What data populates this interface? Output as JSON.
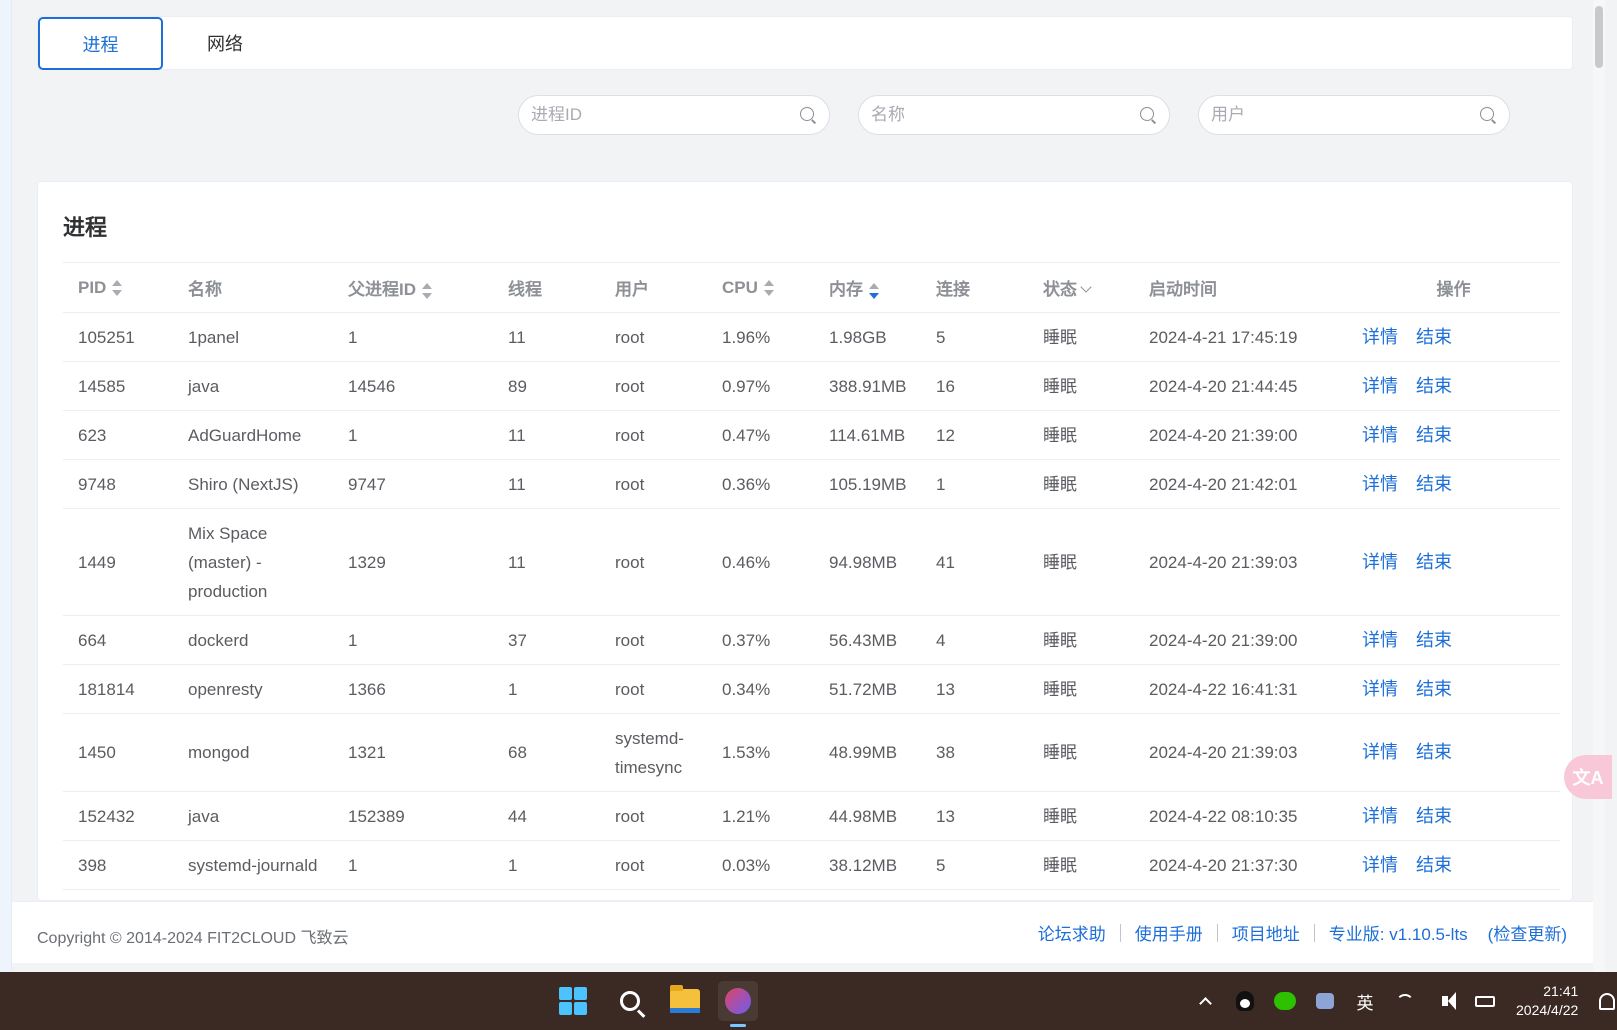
{
  "tabs": [
    {
      "label": "进程",
      "active": true
    },
    {
      "label": "网络",
      "active": false
    }
  ],
  "search": {
    "pid_placeholder": "进程ID",
    "name_placeholder": "名称",
    "user_placeholder": "用户"
  },
  "card": {
    "title": "进程"
  },
  "table": {
    "headers": {
      "pid": "PID",
      "name": "名称",
      "ppid": "父进程ID",
      "threads": "线程",
      "user": "用户",
      "cpu": "CPU",
      "memory": "内存",
      "connections": "连接",
      "status": "状态",
      "start_time": "启动时间",
      "actions": "操作"
    },
    "sort": {
      "active_column": "memory",
      "direction": "descending"
    },
    "action_labels": {
      "detail": "详情",
      "kill": "结束"
    },
    "rows": [
      {
        "pid": "105251",
        "name": "1panel",
        "ppid": "1",
        "threads": "11",
        "user": "root",
        "cpu": "1.96%",
        "memory": "1.98GB",
        "connections": "5",
        "status": "睡眠",
        "start_time": "2024-4-21 17:45:19"
      },
      {
        "pid": "14585",
        "name": "java",
        "ppid": "14546",
        "threads": "89",
        "user": "root",
        "cpu": "0.97%",
        "memory": "388.91MB",
        "connections": "16",
        "status": "睡眠",
        "start_time": "2024-4-20 21:44:45"
      },
      {
        "pid": "623",
        "name": "AdGuardHome",
        "ppid": "1",
        "threads": "11",
        "user": "root",
        "cpu": "0.47%",
        "memory": "114.61MB",
        "connections": "12",
        "status": "睡眠",
        "start_time": "2024-4-20 21:39:00"
      },
      {
        "pid": "9748",
        "name": "Shiro (NextJS)",
        "ppid": "9747",
        "threads": "11",
        "user": "root",
        "cpu": "0.36%",
        "memory": "105.19MB",
        "connections": "1",
        "status": "睡眠",
        "start_time": "2024-4-20 21:42:01"
      },
      {
        "pid": "1449",
        "name": "Mix Space (master) - production",
        "ppid": "1329",
        "threads": "11",
        "user": "root",
        "cpu": "0.46%",
        "memory": "94.98MB",
        "connections": "41",
        "status": "睡眠",
        "start_time": "2024-4-20 21:39:03"
      },
      {
        "pid": "664",
        "name": "dockerd",
        "ppid": "1",
        "threads": "37",
        "user": "root",
        "cpu": "0.37%",
        "memory": "56.43MB",
        "connections": "4",
        "status": "睡眠",
        "start_time": "2024-4-20 21:39:00"
      },
      {
        "pid": "181814",
        "name": "openresty",
        "ppid": "1366",
        "threads": "1",
        "user": "root",
        "cpu": "0.34%",
        "memory": "51.72MB",
        "connections": "13",
        "status": "睡眠",
        "start_time": "2024-4-22 16:41:31"
      },
      {
        "pid": "1450",
        "name": "mongod",
        "ppid": "1321",
        "threads": "68",
        "user": "systemd-timesync",
        "cpu": "1.53%",
        "memory": "48.99MB",
        "connections": "38",
        "status": "睡眠",
        "start_time": "2024-4-20 21:39:03"
      },
      {
        "pid": "152432",
        "name": "java",
        "ppid": "152389",
        "threads": "44",
        "user": "root",
        "cpu": "1.21%",
        "memory": "44.98MB",
        "connections": "13",
        "status": "睡眠",
        "start_time": "2024-4-22 08:10:35"
      },
      {
        "pid": "398",
        "name": "systemd-journald",
        "ppid": "1",
        "threads": "1",
        "user": "root",
        "cpu": "0.03%",
        "memory": "38.12MB",
        "connections": "5",
        "status": "睡眠",
        "start_time": "2024-4-20 21:37:30"
      }
    ]
  },
  "footer": {
    "copyright": "Copyright © 2014-2024 FIT2CLOUD 飞致云",
    "forum": "论坛求助",
    "manual": "使用手册",
    "project": "项目地址",
    "version": "专业版: v1.10.5-lts",
    "check_update": "(检查更新)"
  },
  "translate_widget": {
    "label": "文A",
    "color": "#f9c8d8"
  },
  "taskbar": {
    "apps": [
      "windows-start",
      "search",
      "file-explorer",
      "pinned-app"
    ],
    "ime": "英",
    "time": "21:41",
    "date": "2024/4/22"
  },
  "colors": {
    "primary": "#1d6fd8",
    "taskbar": "#3b2a24",
    "page_bg": "#f2f3f5"
  }
}
